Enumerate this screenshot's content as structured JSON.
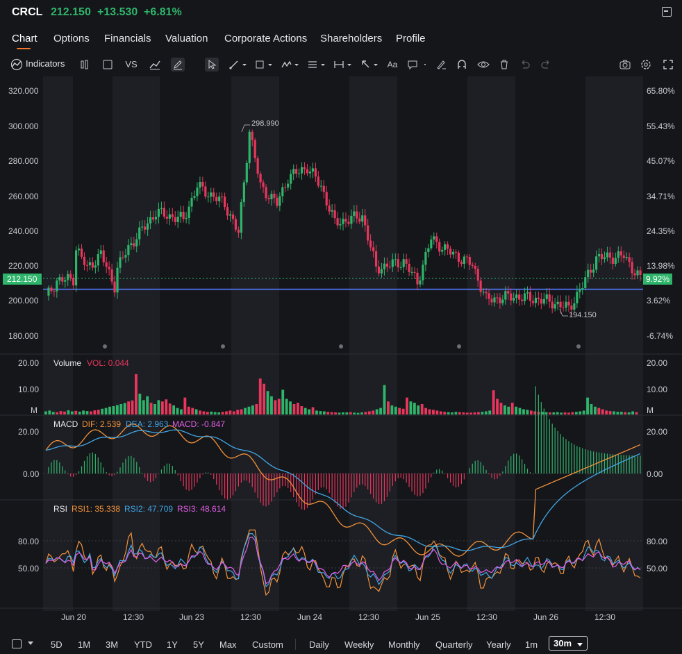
{
  "header": {
    "symbol": "CRCL",
    "price": "212.150",
    "change": "+13.530",
    "change_pct": "+6.81%"
  },
  "tabs": [
    "Chart",
    "Options",
    "Financials",
    "Valuation",
    "Corporate Actions",
    "Shareholders",
    "Profile"
  ],
  "toolbar": {
    "indicators_label": "Indicators",
    "vs_label": "VS",
    "text_label": "Aa"
  },
  "periods": [
    "5D",
    "1M",
    "3M",
    "YTD",
    "1Y",
    "5Y",
    "Max",
    "Custom"
  ],
  "intervals": [
    "Daily",
    "Weekly",
    "Monthly",
    "Quarterly",
    "Yearly",
    "1m"
  ],
  "interval_selected": "30m",
  "colors": {
    "up": "#2fb56b",
    "down": "#e8365d",
    "accent": "#f07a2a",
    "hline": "#4a69d8",
    "dif": "#f3923a",
    "dea": "#41a6e6",
    "macd": "#e25fe6",
    "rsi1": "#f3923a",
    "rsi2": "#41a6e6",
    "rsi3": "#e25fe6"
  },
  "chart_data": {
    "type": "candlestick",
    "price_axis": {
      "ticks": [
        "320.000",
        "300.000",
        "280.000",
        "260.000",
        "240.000",
        "220.000",
        "200.000",
        "180.000"
      ],
      "range": [
        171,
        326
      ]
    },
    "pct_axis": {
      "ticks": [
        "65.80%",
        "55.43%",
        "45.07%",
        "34.71%",
        "24.35%",
        "13.98%",
        "3.62%",
        "-6.74%"
      ]
    },
    "current_price": "212.150",
    "current_pct": "9.92%",
    "horizontal_line": 206,
    "high_label": "298.990",
    "low_label": "194.150",
    "x_labels": [
      "Jun 20",
      "12:30",
      "Jun 23",
      "12:30",
      "Jun 24",
      "12:30",
      "Jun 25",
      "12:30",
      "Jun 26",
      "12:30"
    ],
    "volume": {
      "title": "Volume",
      "readout": "VOL: 0.044",
      "ticks": [
        "20.00",
        "10.00",
        "M"
      ],
      "values": [
        1.2,
        1.5,
        1.0,
        0.9,
        1.3,
        1.1,
        1.6,
        1.2,
        1.4,
        1.1,
        1.5,
        1.3,
        1.2,
        1.6,
        1.8,
        2.2,
        2.5,
        3.0,
        3.2,
        3.6,
        4.0,
        4.4,
        5.0,
        5.4,
        15.5,
        8.0,
        5.5,
        7.0,
        4.5,
        4.0,
        5.5,
        5.0,
        5.8,
        4.2,
        3.5,
        2.5,
        2.0,
        6.5,
        3.0,
        2.5,
        2.0,
        1.5,
        1.2,
        1.0,
        1.1,
        0.9,
        0.8,
        1.0,
        1.2,
        1.5,
        1.2,
        1.8,
        2.0,
        2.5,
        3.0,
        3.5,
        4.0,
        13.8,
        11.8,
        9.0,
        7.0,
        5.5,
        6.0,
        9.5,
        6.0,
        5.0,
        4.0,
        4.5,
        3.2,
        2.5,
        2.0,
        2.8,
        1.5,
        1.3,
        1.2,
        1.0,
        0.9,
        0.8,
        0.7,
        0.8,
        0.8,
        0.9,
        0.7,
        0.6,
        0.8,
        1.0,
        1.2,
        1.5,
        2.0,
        2.5,
        11.3,
        5.0,
        3.5,
        3.0,
        2.5,
        2.2,
        6.5,
        5.0,
        4.5,
        3.5,
        4.0,
        2.5,
        2.0,
        1.8,
        1.5,
        1.2,
        1.0,
        0.9,
        0.8,
        1.0,
        0.9,
        0.8,
        0.7,
        0.7,
        0.8,
        0.9,
        1.0,
        1.2,
        1.5,
        9.3,
        6.0,
        4.5,
        3.5,
        3.0,
        4.5,
        3.0,
        2.5,
        2.0,
        1.8,
        1.5,
        1.2,
        1.0,
        1.0,
        0.9,
        0.8,
        0.8,
        0.9,
        0.7,
        0.8,
        0.7,
        0.9,
        1.0,
        1.2,
        1.5,
        6.5,
        4.0,
        3.0,
        2.5,
        2.0,
        1.5,
        1.3,
        1.2,
        1.0,
        1.0,
        0.9,
        0.8,
        1.2,
        0.9
      ]
    },
    "macd": {
      "title": "MACD",
      "dif": "DIF: 2.539",
      "dea": "DEA: 2.963",
      "macd": "MACD: -0.847",
      "ticks": [
        "20.00",
        "0.00"
      ]
    },
    "rsi": {
      "title": "RSI",
      "rsi1": "RSI1: 35.338",
      "rsi2": "RSI2: 47.709",
      "rsi3": "RSI3: 48.614",
      "ticks": [
        "80.00",
        "50.00"
      ]
    }
  }
}
